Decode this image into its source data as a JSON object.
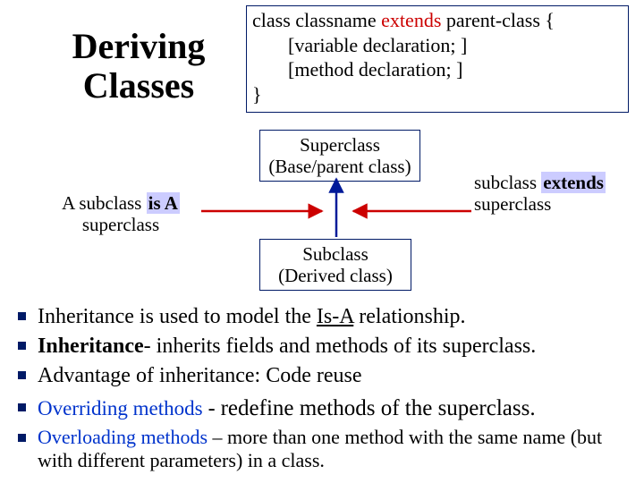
{
  "title": "Deriving Classes",
  "code": {
    "l1a": "class classname ",
    "l1b": "extends",
    "l1c": " parent-class {",
    "l2": "[variable declaration; ]",
    "l3": "[method declaration; ]",
    "l4": "}"
  },
  "diagram": {
    "superclass_l1": "Superclass",
    "superclass_l2": "(Base/parent class)",
    "subclass_l1": "Subclass",
    "subclass_l2": "(Derived class)",
    "left_l1a": "A subclass ",
    "left_l1b": "is A",
    "left_l2": "superclass",
    "right_l1a": "subclass ",
    "right_l1b": "extends",
    "right_l2": "superclass"
  },
  "bullets1": {
    "b1a": "Inheritance is used to model the ",
    "b1b": "Is-A",
    "b1c": " relationship.",
    "b2a": "Inheritance",
    "b2b": "- inherits fields and methods of its superclass.",
    "b3": "Advantage of inheritance: Code reuse"
  },
  "bullets2": {
    "b1a": "Overriding methods",
    "b1b": " - ",
    "b1c": "redefine methods of the superclass.",
    "b2a": "Overloading methods",
    "b2b": " – more than one method with the same name (but with different parameters) in a class."
  }
}
